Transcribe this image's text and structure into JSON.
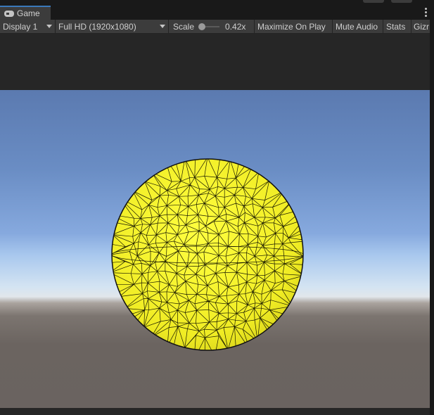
{
  "tab": {
    "label": "Game",
    "icon": "gamepad-icon"
  },
  "toolbar": {
    "display": "Display 1",
    "resolution": "Full HD (1920x1080)",
    "scale_label": "Scale",
    "scale_value": "0.42x",
    "maximize": "Maximize On Play",
    "mute": "Mute Audio",
    "stats": "Stats",
    "gizmos": "Gizr"
  },
  "colors": {
    "accent": "#3a79bb",
    "sphere": "#f2ef2a",
    "wire": "#1b1b00"
  }
}
